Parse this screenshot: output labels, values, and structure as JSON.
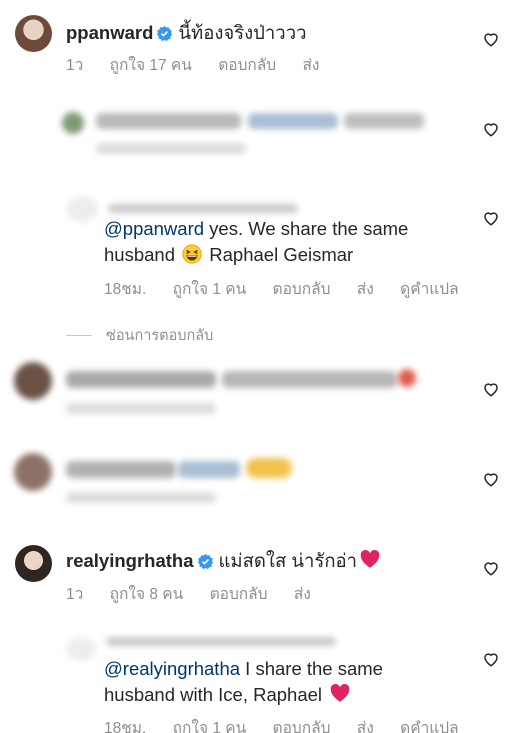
{
  "comments": [
    {
      "username": "ppanward",
      "verified": true,
      "text": "นี้ท้องจริงป่าววว",
      "meta": {
        "time": "1ว",
        "likes": "ถูกใจ 17 คน",
        "reply": "ตอบกลับ",
        "send": "ส่ง"
      }
    },
    {
      "reply_to": "@ppanward",
      "text1": " yes. We share the same",
      "text2": "husband",
      "text3": " Raphael Geismar",
      "meta": {
        "time": "18ชม.",
        "likes": "ถูกใจ 1 คน",
        "reply": "ตอบกลับ",
        "send": "ส่ง",
        "translate": "ดูคำแปล"
      }
    },
    {
      "username": "realyingrhatha",
      "verified": true,
      "text": "แม่สดใส น่ารักอ่า",
      "meta": {
        "time": "1ว",
        "likes": "ถูกใจ 8 คน",
        "reply": "ตอบกลับ",
        "send": "ส่ง"
      }
    },
    {
      "reply_to": "@realyingrhatha",
      "text1": " I share the same",
      "text2": "husband with Ice, Raphael",
      "meta": {
        "time": "18ชม.",
        "likes": "ถูกใจ 1 คน",
        "reply": "ตอบกลับ",
        "send": "ส่ง",
        "translate": "ดูคำแปล"
      }
    }
  ],
  "hide_replies": "ซ่อนการตอบกลับ",
  "icons": {
    "like": "heart-outline-icon",
    "verified": "verified-badge-icon",
    "laugh": "grinning-squinting-face-emoji",
    "red_heart": "red-heart-emoji"
  },
  "colors": {
    "text": "#262626",
    "meta": "#8e8e8e",
    "mention": "#00376b",
    "verified": "#3897f0",
    "heart_emoji": "#e0245e"
  }
}
